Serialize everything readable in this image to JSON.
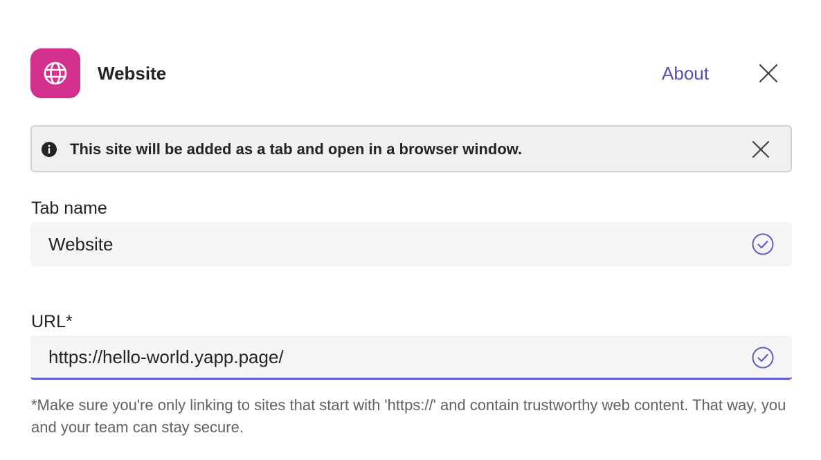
{
  "colors": {
    "app_icon_bg": "#d32f8f",
    "accent": "#5b5fc7",
    "link": "#4f52b2"
  },
  "header": {
    "app_icon": "globe-icon",
    "title": "Website",
    "about_label": "About",
    "close_icon": "close-icon"
  },
  "banner": {
    "icon": "info-icon",
    "text": "This site will be added as a tab and open in a browser window.",
    "close_icon": "close-icon"
  },
  "tab_name": {
    "label": "Tab name",
    "value": "Website",
    "status_icon": "check-circle-icon"
  },
  "url": {
    "label": "URL*",
    "value": "https://hello-world.yapp.page/",
    "status_icon": "check-circle-icon"
  },
  "helper_text": "*Make sure you're only linking to sites that start with 'https://' and contain trustworthy web content. That way, you and your team can stay secure."
}
